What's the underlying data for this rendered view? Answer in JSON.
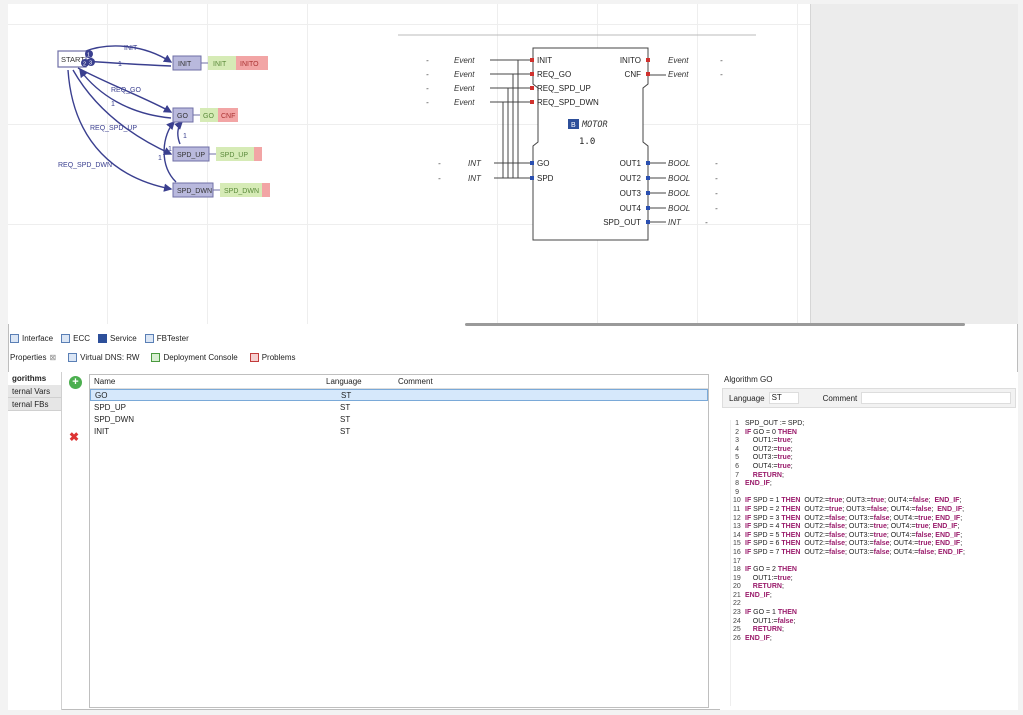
{
  "ecc": {
    "start_label": "START",
    "states": [
      {
        "name": "INIT",
        "action_alg": "INIT",
        "action_event": "INITO"
      },
      {
        "name": "GO",
        "action_alg": "GO",
        "action_event": "CNF"
      },
      {
        "name": "SPD_UP",
        "action_alg": "SPD_UP",
        "action_event": ""
      },
      {
        "name": "SPD_DWN",
        "action_alg": "SPD_DWN",
        "action_event": ""
      }
    ],
    "transitions": [
      "INIT",
      "1",
      "REQ_GO",
      "1",
      "REQ_SPD_UP",
      "1",
      "1",
      "REQ_SPD_DWN",
      "1"
    ],
    "start_badges": [
      "1",
      "2",
      "3"
    ]
  },
  "fb": {
    "type_name": "MOTOR",
    "version": "1.0",
    "badge": "B",
    "inputs_events": [
      {
        "type": "Event",
        "port": "INIT"
      },
      {
        "type": "Event",
        "port": "REQ_GO"
      },
      {
        "type": "Event",
        "port": "REQ_SPD_UP"
      },
      {
        "type": "Event",
        "port": "REQ_SPD_DWN"
      }
    ],
    "output_events": [
      {
        "port": "INITO",
        "type": "Event"
      },
      {
        "port": "CNF",
        "type": "Event"
      }
    ],
    "input_data": [
      {
        "type": "INT",
        "port": "GO"
      },
      {
        "type": "INT",
        "port": "SPD"
      }
    ],
    "output_data": [
      {
        "port": "OUT1",
        "type": "BOOL"
      },
      {
        "port": "OUT2",
        "type": "BOOL"
      },
      {
        "port": "OUT3",
        "type": "BOOL"
      },
      {
        "port": "OUT4",
        "type": "BOOL"
      },
      {
        "port": "SPD_OUT",
        "type": "INT"
      }
    ],
    "dash": "-"
  },
  "editor_tabs": [
    "Interface",
    "ECC",
    "Service",
    "FBTester"
  ],
  "view_tabs": [
    "Properties",
    "Virtual DNS: RW",
    "Deployment Console",
    "Problems"
  ],
  "left_panel": [
    "gorithms",
    "ternal Vars",
    "ternal FBs"
  ],
  "table": {
    "headers": {
      "name": "Name",
      "language": "Language",
      "comment": "Comment"
    },
    "rows": [
      {
        "name": "GO",
        "language": "ST"
      },
      {
        "name": "SPD_UP",
        "language": "ST"
      },
      {
        "name": "SPD_DWN",
        "language": "ST"
      },
      {
        "name": "INIT",
        "language": "ST"
      }
    ]
  },
  "algorithm": {
    "title": "Algorithm GO",
    "language_label": "Language",
    "language_value": "ST",
    "comment_label": "Comment",
    "code": [
      "SPD_OUT := SPD;",
      "IF GO = 0 THEN",
      "    OUT1:=true;",
      "    OUT2:=true;",
      "    OUT3:=true;",
      "    OUT4:=true;",
      "    RETURN;",
      "END_IF;",
      "",
      "IF SPD = 1 THEN  OUT2:=true; OUT3:=true; OUT4:=false;  END_IF;",
      "IF SPD = 2 THEN  OUT2:=true; OUT3:=false; OUT4:=false;  END_IF;",
      "IF SPD = 3 THEN  OUT2:=false; OUT3:=false; OUT4:=true; END_IF;",
      "IF SPD = 4 THEN  OUT2:=false; OUT3:=true; OUT4:=true; END_IF;",
      "IF SPD = 5 THEN  OUT2:=false; OUT3:=true; OUT4:=false; END_IF;",
      "IF SPD = 6 THEN  OUT2:=false; OUT3:=false; OUT4:=true; END_IF;",
      "IF SPD = 7 THEN  OUT2:=false; OUT3:=false; OUT4:=false; END_IF;",
      "",
      "IF GO = 2 THEN",
      "    OUT1:=true;",
      "    RETURN;",
      "END_IF;",
      "",
      "IF GO = 1 THEN",
      "    OUT1:=false;",
      "    RETURN;",
      "END_IF;"
    ]
  },
  "colors": {
    "state_fill": "#b9b9dd",
    "state_stroke": "#6f6fa6",
    "alg_fill": "#d6ebb6",
    "event_fill": "#f2a5a5",
    "arc": "#3a3f8f",
    "keyword": "#9a1b6b",
    "port_event": "#d0312d",
    "port_data": "#2a4fb0"
  }
}
